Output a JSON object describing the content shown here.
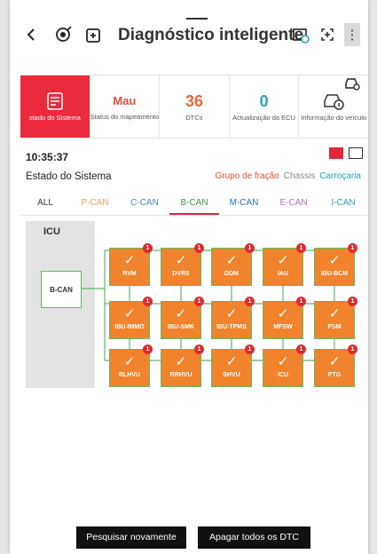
{
  "header": {
    "title": "Diagnóstico inteligente"
  },
  "cards": [
    {
      "value": "",
      "label": "stado do Sistema"
    },
    {
      "value": "Mau",
      "label": "Status do mapeamento"
    },
    {
      "value": "36",
      "label": "DTCs"
    },
    {
      "value": "0",
      "label": "Actualização da ECU"
    },
    {
      "value": "",
      "label": "Informação do veículo"
    }
  ],
  "time": "10:35:37",
  "state_title": "Estado do Sistema",
  "filters": {
    "group": "Grupo de fração",
    "chassis": "Chassis",
    "body": "Carroçaria"
  },
  "tabs": [
    "ALL",
    "P-CAN",
    "C-CAN",
    "B-CAN",
    "M-CAN",
    "E-CAN",
    "I-CAN"
  ],
  "diagram": {
    "icu_title": "ICU",
    "bus_label": "B-CAN",
    "ecus": [
      "RVM",
      "DVRS",
      "DDM",
      "IAU",
      "IBU-BCM",
      "IBU-IMMO",
      "IBU-SMK",
      "IBU-TPMS",
      "MFSW",
      "PSM",
      "RLHVU",
      "RRHVU",
      "SHVU",
      "ICU",
      "PTG"
    ],
    "badge": "1"
  },
  "buttons": {
    "search_again": "Pesquisar novamente",
    "clear_dtc": "Apagar todos os DTC"
  },
  "colors": {
    "accent": "#ea2b3b",
    "ecu_fill": "#f0832c",
    "link_green": "#61b865"
  }
}
